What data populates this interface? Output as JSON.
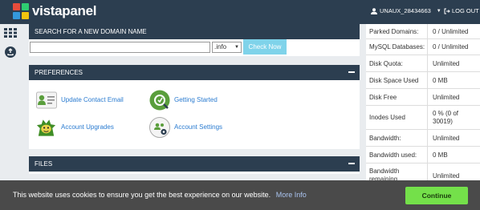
{
  "header": {
    "logo_text": "vistapanel",
    "username": "UNAUX_28434663",
    "logout_label": "LOG OUT",
    "logo_colors": [
      "#e74c3c",
      "#2ecc71",
      "#3498db",
      "#f1c40f"
    ]
  },
  "rail": {
    "icons": [
      "apps-grid-icon",
      "upload-icon"
    ]
  },
  "search_panel": {
    "title": "SEARCH FOR A NEW DOMAIN NAME",
    "input_value": "",
    "tld_selected": ".info",
    "button_label": "Check Now"
  },
  "preferences": {
    "title": "PREFERENCES",
    "items": [
      {
        "label": "Update Contact Email",
        "icon": "contact-card-icon"
      },
      {
        "label": "Getting Started",
        "icon": "getting-started-icon"
      },
      {
        "label": "Account Upgrades",
        "icon": "upgrade-mascot-icon"
      },
      {
        "label": "Account Settings",
        "icon": "account-settings-icon"
      }
    ]
  },
  "files": {
    "title": "FILES"
  },
  "stats": [
    {
      "key": "Parked Domains:",
      "value": "0 / Unlimited"
    },
    {
      "key": "MySQL Databases:",
      "value": "0 / Unlimited"
    },
    {
      "key": "Disk Quota:",
      "value": "Unlimited"
    },
    {
      "key": "Disk Space Used",
      "value": "0 MB"
    },
    {
      "key": "Disk Free",
      "value": "Unlimited"
    },
    {
      "key": "Inodes Used",
      "value": "0 % (0 of 30019)"
    },
    {
      "key": "Bandwidth:",
      "value": "Unlimited"
    },
    {
      "key": "Bandwidth used:",
      "value": "0 MB"
    },
    {
      "key": "Bandwidth remaining",
      "value": "Unlimited"
    }
  ],
  "cookie": {
    "message": "This website uses cookies to ensure you get the best experience on our website.",
    "more_info": "More Info",
    "accept_label": "Continue"
  },
  "colors": {
    "header_bg": "#2c3e50",
    "accent_button": "#7fd3ea",
    "link": "#2a7bd0",
    "cookie_accept": "#74e04a"
  }
}
